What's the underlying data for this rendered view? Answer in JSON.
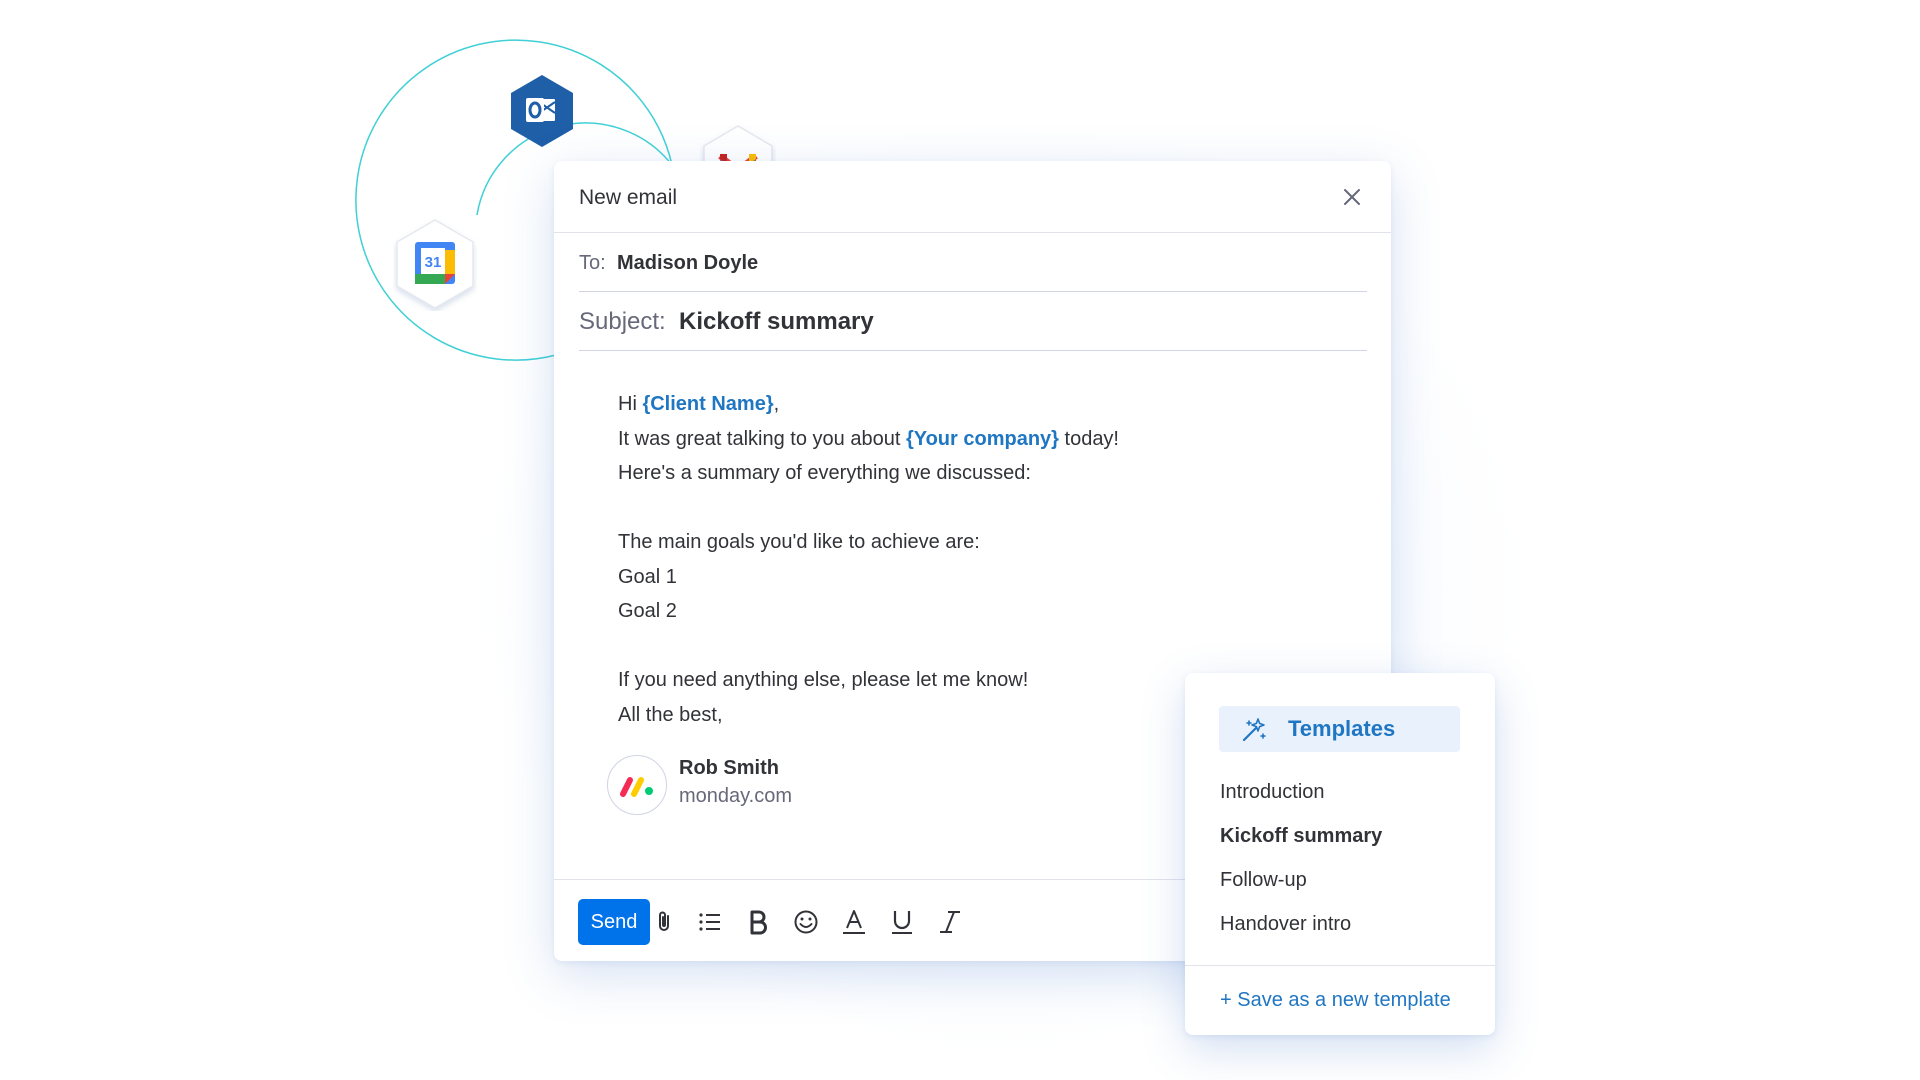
{
  "window": {
    "title": "New email"
  },
  "email": {
    "to_label": "To:",
    "to_value": "Madison Doyle",
    "subject_label": "Subject:",
    "subject_value": "Kickoff summary",
    "body": {
      "greeting_prefix": "Hi ",
      "client_var": "{Client Name}",
      "greeting_suffix": ",",
      "line2_prefix": "It was great talking to you about ",
      "company_var": "{Your company}",
      "line2_suffix": " today!",
      "line3": "Here's a summary of everything we discussed:",
      "line5": "The main goals you'd like to achieve are:",
      "line6": "Goal 1",
      "line7": "Goal 2",
      "line9": "If you need anything else, please let me know!",
      "line10": "All the best,"
    },
    "signature": {
      "name": "Rob Smith",
      "company": "monday.com"
    }
  },
  "toolbar": {
    "send_label": "Send",
    "icons": [
      "attachment-icon",
      "bulleted-list-icon",
      "bold-icon",
      "emoji-icon",
      "text-color-icon",
      "underline-icon",
      "italic-icon"
    ]
  },
  "templates": {
    "title": "Templates",
    "items": [
      "Introduction",
      "Kickoff summary",
      "Follow-up",
      "Handover intro"
    ],
    "active": "Kickoff summary",
    "save_label": "+ Save as a new template"
  },
  "integrations": [
    "outlook-icon",
    "gmail-icon",
    "google-calendar-icon"
  ],
  "calendar_day": "31",
  "colors": {
    "accent": "#0073ea",
    "link": "#1f76c2",
    "orbit": "#3fd0d6",
    "templates_bg": "#e9f1fd",
    "outlook": "#1f5fa8",
    "text": "#323338",
    "muted": "#676879"
  }
}
